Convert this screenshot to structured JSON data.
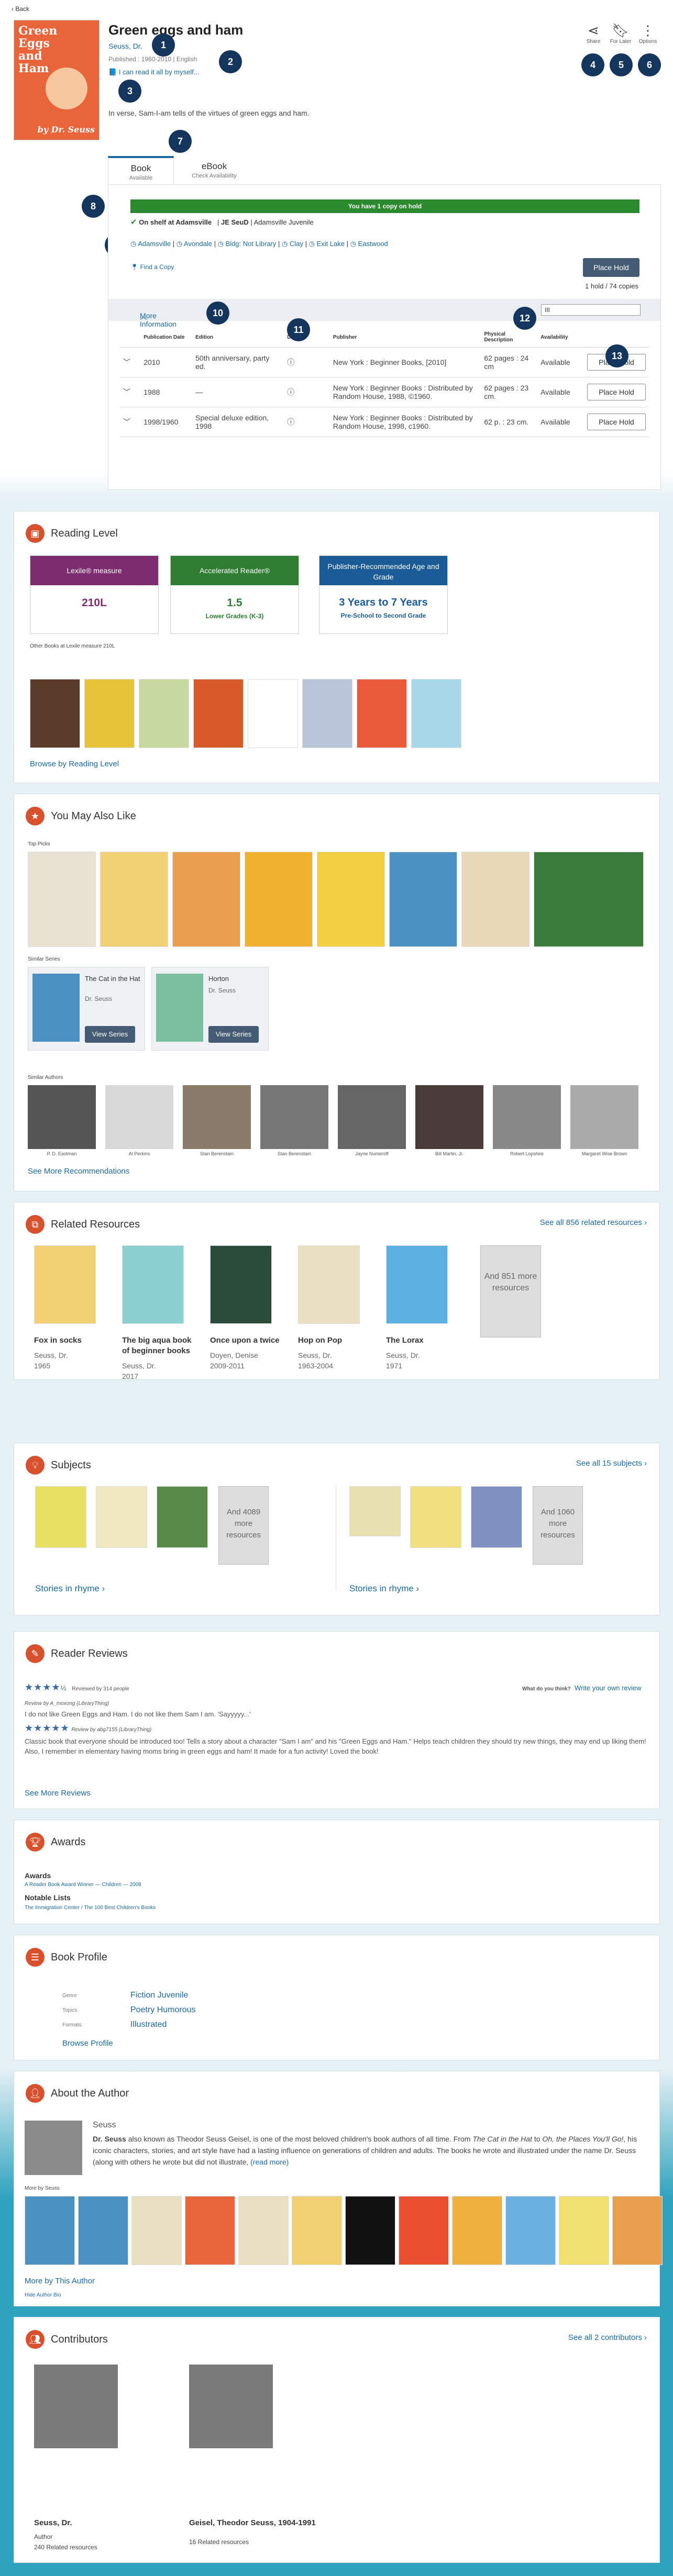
{
  "back": "Back",
  "book": {
    "title": "Green eggs and ham",
    "author": "Seuss, Dr.",
    "published": "Published : 1960-2010 | English",
    "series": "I can read it all by myself...",
    "description": "In verse, Sam-I-am tells of the virtues of green eggs and ham.",
    "cover_title": "Green Eggs and Ham",
    "cover_author": "by Dr. Seuss"
  },
  "actions": {
    "share": "Share",
    "for_later": "For Later",
    "options": "Options"
  },
  "markers": [
    "1",
    "2",
    "3",
    "4",
    "5",
    "6",
    "7",
    "8",
    "9",
    "10",
    "11",
    "12",
    "13"
  ],
  "tabs": [
    {
      "label": "Book",
      "sub": "Available"
    },
    {
      "label": "eBook",
      "sub": "Check Availability"
    }
  ],
  "hold": {
    "banner": "You have 1 copy on hold",
    "shelf_status": "On shelf at Adamsville",
    "call_number": "JE SeuD",
    "shelf_loc": "Adamsville Juvenile",
    "locations": [
      "Adamsville",
      "Avondale",
      "Bldg: Not Library",
      "Clay",
      "Exit Lake",
      "Eastwood"
    ],
    "find_copy": "Find a Copy",
    "place_hold": "Place Hold",
    "hold_count": "1 hold / 74 copies",
    "more_info": "More Information",
    "filter": "III"
  },
  "copies_table": {
    "headers": [
      "",
      "Publication Date",
      "Edition",
      "Details",
      "Publisher",
      "Physical Description",
      "Availability",
      ""
    ],
    "rows": [
      {
        "date": "2010",
        "edition": "50th anniversary, party ed.",
        "publisher": "New York : Beginner Books, [2010]",
        "phys": "62 pages : 24 cm",
        "avail": "Available",
        "btn": "Place Hold"
      },
      {
        "date": "1988",
        "edition": "—",
        "publisher": "New York : Beginner Books : Distributed by Random House, 1988, ©1960.",
        "phys": "62 pages : 23 cm.",
        "avail": "Available",
        "btn": "Place Hold"
      },
      {
        "date": "1998/1960",
        "edition": "Special deluxe edition, 1998",
        "publisher": "New York : Beginner Books : Distributed by Random House, 1998, c1960.",
        "phys": "62 p. : 23 cm.",
        "avail": "Available",
        "btn": "Place Hold"
      }
    ]
  },
  "reading_level": {
    "title": "Reading Level",
    "boxes": [
      {
        "head": "Lexile® measure",
        "value": "210L",
        "sub": "",
        "color": "#7b2d6e",
        "valcolor": "#7b2d6e"
      },
      {
        "head": "Accelerated Reader®",
        "value": "1.5",
        "sub": "Lower Grades (K-3)",
        "color": "#2e7d32",
        "valcolor": "#2e7d32"
      },
      {
        "head": "Publisher-Recommended Age and Grade",
        "value": "3 Years to 7 Years",
        "sub": "Pre-School to Second Grade",
        "color": "#1a5b96",
        "valcolor": "#1a5b96"
      }
    ],
    "other_label": "Other Books at Lexile measure 210L",
    "browse": "Browse by Reading Level"
  },
  "also_like": {
    "title": "You May Also Like",
    "top_picks": "Top Picks",
    "similar_series": "Similar Series",
    "series": [
      {
        "name": "The Cat in the Hat",
        "author": "Dr. Seuss",
        "btn": "View Series"
      },
      {
        "name": "Horton",
        "author": "Dr. Seuss",
        "btn": "View Series"
      }
    ],
    "similar_authors": "Similar Authors",
    "authors": [
      "P. D. Eastman",
      "Al Perkins",
      "Stan Berenstain",
      "Stan Berenstain",
      "Jayne Numeroff",
      "Bill Martin, Jr.",
      "Robert Lopshire",
      "Margaret Wise Brown"
    ],
    "see_more": "See More Recommendations"
  },
  "related": {
    "title": "Related Resources",
    "see_all": "See all 856 related resources",
    "items": [
      {
        "title": "Fox in socks",
        "author": "Seuss, Dr.",
        "year": "1965"
      },
      {
        "title": "The big aqua book of beginner books",
        "author": "Seuss, Dr.",
        "year": "2017"
      },
      {
        "title": "Once upon a twice",
        "author": "Doyen, Denise",
        "year": "2009-2011"
      },
      {
        "title": "Hop on Pop",
        "author": "Seuss, Dr.",
        "year": "1963-2004"
      },
      {
        "title": "The Lorax",
        "author": "Seuss, Dr.",
        "year": "1971"
      }
    ],
    "more": "And 851 more resources"
  },
  "subjects": {
    "title": "Subjects",
    "see_all": "See all 15 subjects",
    "groups": [
      {
        "more": "And 4089 more resources",
        "link": "Stories in rhyme"
      },
      {
        "more": "And 1060 more resources",
        "link": "Stories in rhyme"
      }
    ]
  },
  "reviews": {
    "title": "Reader Reviews",
    "summary": "Reviewed by 314 people",
    "half": "½",
    "what_think": "What do you think?",
    "write": "Write your own review",
    "items": [
      {
        "by": "Review by A_moxong (LibraryThing)",
        "text": "I do not like Green Eggs and Ham. I do not like them Sam I am.  'Sayyyyy...'"
      },
      {
        "by": "Review by abg7155 (LibraryThing)",
        "text": "Classic book that everyone should be introduced too! Tells a story about a character \"Sam I am\" and his \"Green Eggs and Ham.\" Helps teach children they should try new things, they may end up liking them! Also, I remember in elementary having moms bring in green eggs and ham! It made for a fun activity! Loved the book!"
      }
    ],
    "see_more": "See More Reviews"
  },
  "awards": {
    "title": "Awards",
    "awards_label": "Awards",
    "award": "A Reader Book Award Winner — Children — 2008",
    "notable_label": "Notable Lists",
    "notable": "The Immigration Center / The 100 Best Children's Books"
  },
  "profile": {
    "title": "Book Profile",
    "rows": [
      {
        "label": "Genre",
        "value": "Fiction Juvenile"
      },
      {
        "label": "Topics",
        "value": "Poetry Humorous"
      },
      {
        "label": "Formats",
        "value": "Illustrated"
      }
    ],
    "browse": "Browse Profile"
  },
  "about": {
    "title": "About the Author",
    "name": "Seuss",
    "bold": "Dr. Seuss",
    "bio_a": " also known as Theodor Seuss Geisel, is one of the most beloved children's book authors of all time. From ",
    "bio_b": "The Cat in the Hat",
    "bio_c": " to ",
    "bio_d": "Oh, the Places You'll Go!",
    "bio_e": ", his iconic characters, stories, and art style have had a lasting influence on generations of children and adults. The books he wrote and illustrated under the name Dr. Seuss (along with others he wrote but did not illustrate,",
    "read_more": "(read more)",
    "more_label": "More by Seuss",
    "more_link": "More by This Author",
    "hide": "Hide Author Bio"
  },
  "contributors": {
    "title": "Contributors",
    "see_all": "See all 2 contributors",
    "people": [
      {
        "name": "Seuss, Dr.",
        "role": "Author",
        "count": "240 Related resources"
      },
      {
        "name": "Geisel, Theodor Seuss, 1904-1991",
        "role": "",
        "count": "16 Related resources"
      }
    ]
  },
  "colors": {
    "accent": "#1a6aa0",
    "brand": "#d8512e",
    "green": "#2c8a2e",
    "marker": "#14365c"
  }
}
